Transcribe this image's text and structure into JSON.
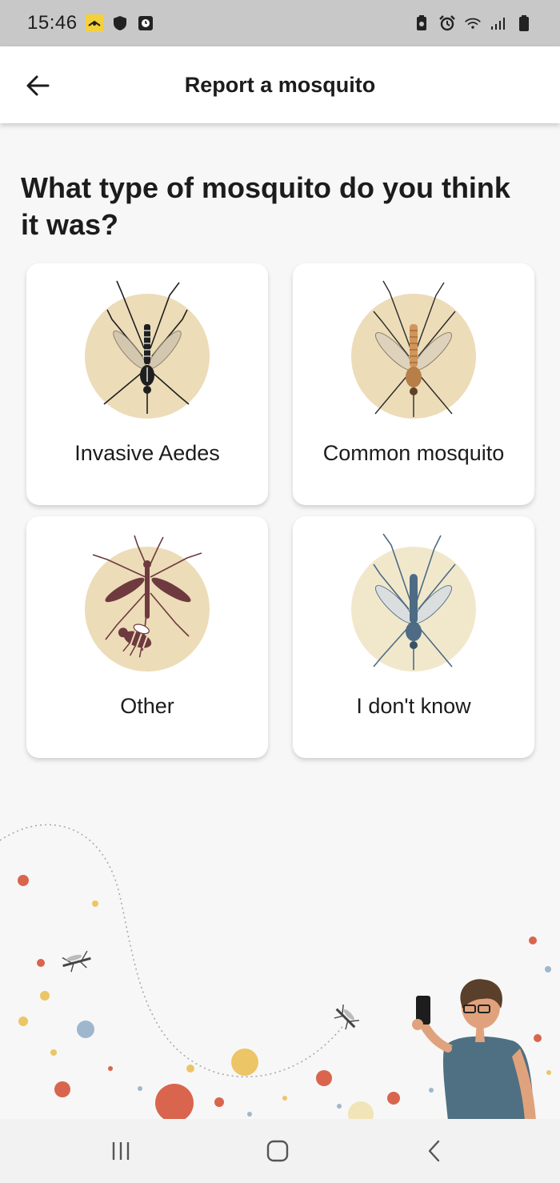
{
  "status_bar": {
    "time": "15:46",
    "left_icons": [
      "mosquito-alert-app-icon",
      "shield-icon",
      "clock-app-icon"
    ],
    "right_icons": [
      "battery-saver-icon",
      "alarm-icon",
      "wifi-icon",
      "signal-icon",
      "battery-icon"
    ]
  },
  "app_bar": {
    "title": "Report a mosquito",
    "back_icon": "arrow-left-icon"
  },
  "question": "What type of mosquito do you think it was?",
  "options": [
    {
      "label": "Invasive Aedes",
      "icon": "aedes-mosquito-icon",
      "circle_color": "#ecdcb8",
      "body_color": "#1f1f1f"
    },
    {
      "label": "Common mosquito",
      "icon": "common-mosquito-icon",
      "circle_color": "#ecdcb8",
      "body_color": "#b57f47"
    },
    {
      "label": "Other",
      "icon": "other-insects-icon",
      "circle_color": "#ecdcb8",
      "body_color": "#6e3a3f"
    },
    {
      "label": "I don't know",
      "icon": "unknown-mosquito-icon",
      "circle_color": "#f1e8cc",
      "body_color": "#4d6b85"
    }
  ],
  "nav_bar": {
    "icons": [
      "recent-apps-icon",
      "home-icon",
      "nav-back-icon"
    ]
  },
  "colors": {
    "status_bar_bg": "#c8c8c8",
    "page_bg": "#f7f7f7",
    "card_bg": "#ffffff",
    "dot_red": "#d9654e",
    "dot_yellow": "#ecc566",
    "dot_blue": "#9fb7cc",
    "person_shirt": "#4f7082"
  }
}
